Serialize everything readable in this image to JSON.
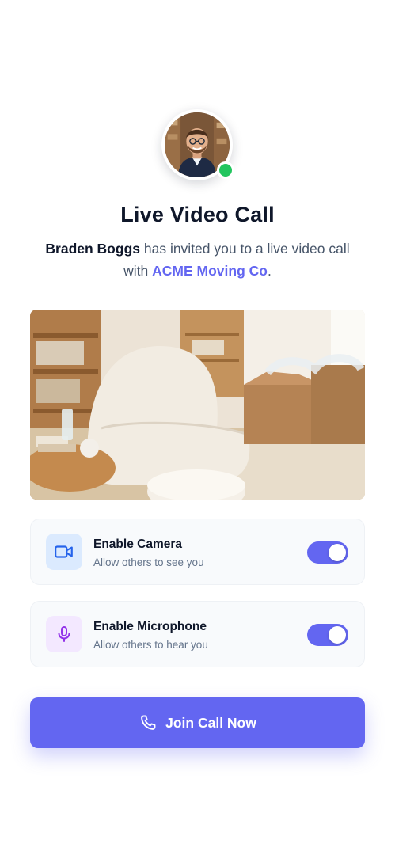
{
  "title": "Live Video Call",
  "invite": {
    "inviter": "Braden Boggs",
    "text_mid": " has invited you to a live video call",
    "text_with": "with ",
    "company": "ACME Moving Co",
    "text_end": "."
  },
  "avatar": {
    "status": "online",
    "status_color": "#22c55e"
  },
  "toggles": [
    {
      "label": "Enable Camera",
      "description": "Allow others to see you",
      "icon": "video-camera-icon",
      "enabled": true
    },
    {
      "label": "Enable Microphone",
      "description": "Allow others to hear you",
      "icon": "microphone-icon",
      "enabled": true
    }
  ],
  "join_button": {
    "label": "Join Call Now",
    "icon": "phone-icon"
  },
  "colors": {
    "accent": "#6366f1",
    "camera_icon": "#2563eb",
    "mic_icon": "#9333ea"
  }
}
